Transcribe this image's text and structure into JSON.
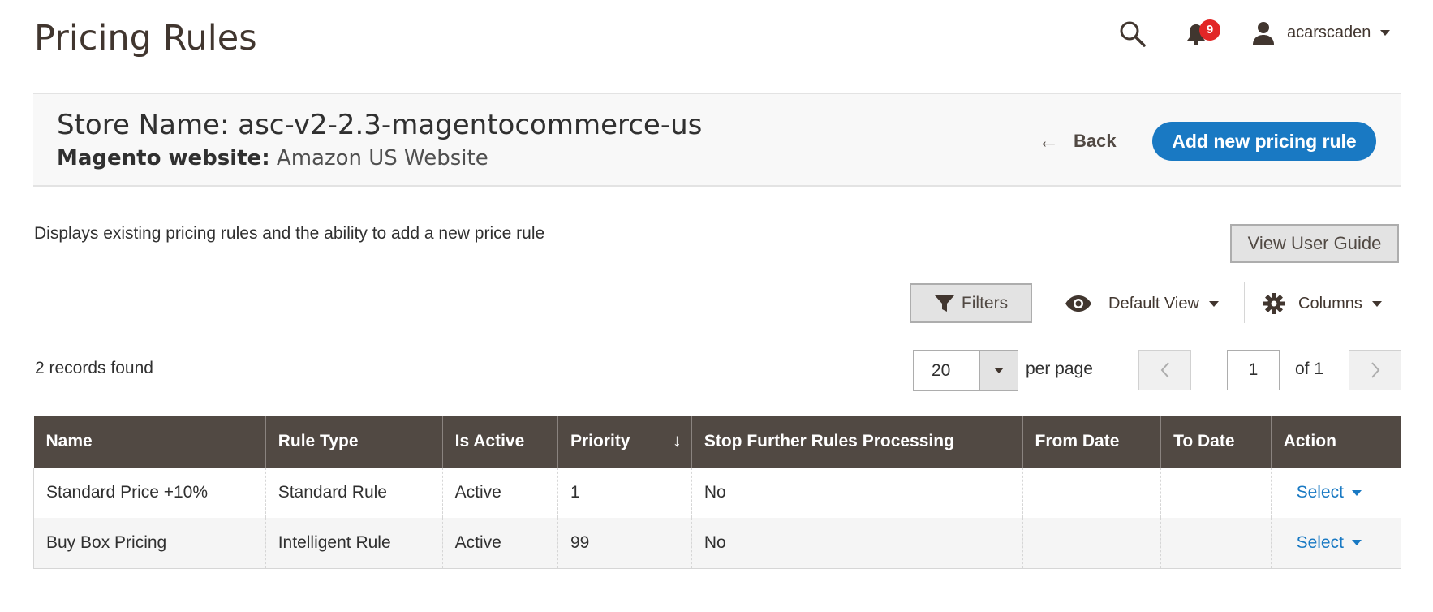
{
  "page": {
    "title": "Pricing Rules"
  },
  "header": {
    "notifications_count": "9",
    "username": "acarscaden"
  },
  "store": {
    "name": "Store Name: asc-v2-2.3-magentocommerce-us",
    "website_label": "Magento website:",
    "website_value": "Amazon US Website",
    "back_label": "Back",
    "add_label": "Add new pricing rule"
  },
  "description": "Displays existing pricing rules and the ability to add a new price rule",
  "guide_label": "View User Guide",
  "toolbar": {
    "filters_label": "Filters",
    "view_label": "Default View",
    "columns_label": "Columns"
  },
  "pager": {
    "records_text": "2 records found",
    "per_page_value": "20",
    "per_page_label": "per page",
    "current_page": "1",
    "of_label": "of 1"
  },
  "grid": {
    "columns": [
      "Name",
      "Rule Type",
      "Is Active",
      "Priority",
      "Stop Further Rules Processing",
      "From Date",
      "To Date",
      "Action"
    ],
    "rows": [
      {
        "name": "Standard Price +10%",
        "rule_type": "Standard Rule",
        "is_active": "Active",
        "priority": "1",
        "stop": "No",
        "from": "",
        "to": "",
        "action": "Select"
      },
      {
        "name": "Buy Box Pricing",
        "rule_type": "Intelligent Rule",
        "is_active": "Active",
        "priority": "99",
        "stop": "No",
        "from": "",
        "to": "",
        "action": "Select"
      }
    ]
  },
  "colors": {
    "accent": "#1979c3",
    "header_bg": "#514943",
    "badge": "#e22626"
  },
  "icons": [
    "search-icon",
    "bell-icon",
    "user-icon",
    "arrow-left-icon",
    "filter-icon",
    "eye-icon",
    "gear-icon",
    "chevron-left-icon",
    "chevron-right-icon",
    "sort-down-icon"
  ]
}
